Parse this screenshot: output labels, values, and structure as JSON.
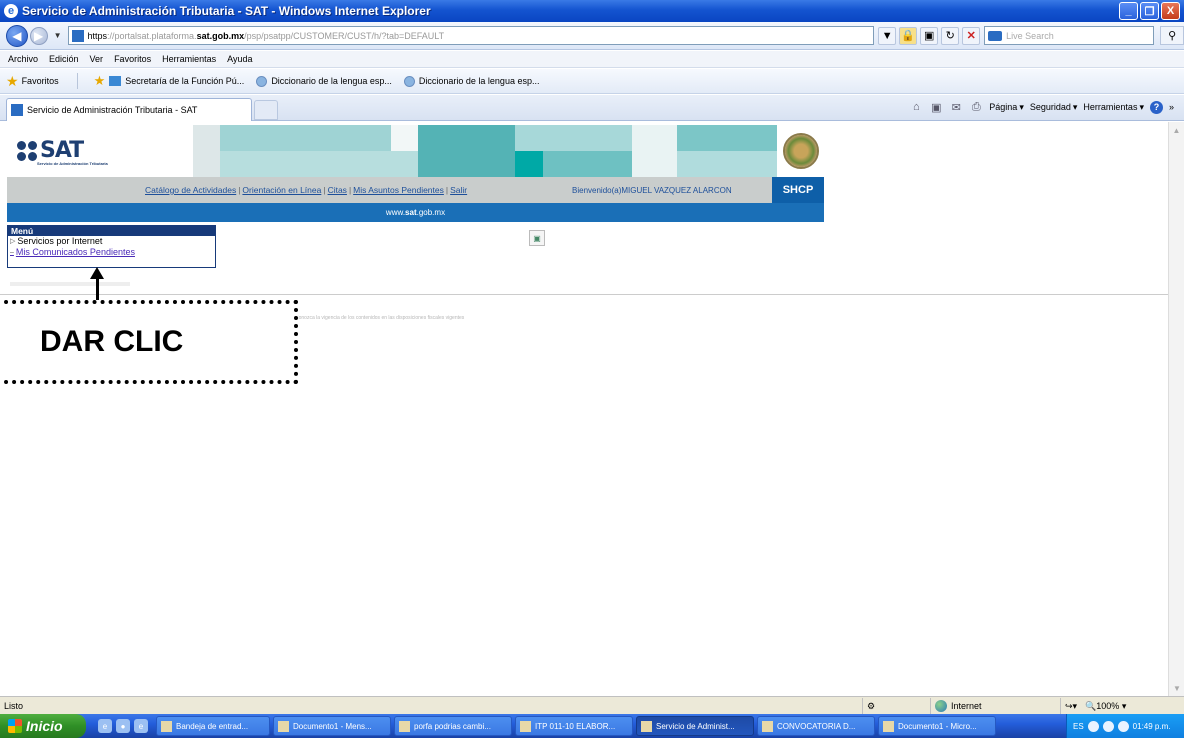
{
  "window": {
    "title": "Servicio de Administración Tributaria - SAT - Windows Internet Explorer",
    "controls": [
      "_",
      "❐",
      "X"
    ]
  },
  "address_bar": {
    "url_scheme": "https",
    "url_prefix": "://portalsat.plataforma.",
    "url_domain": "sat.gob.mx",
    "url_suffix": "/psp/psatpp/CUSTOMER/CUST/h/?tab=DEFAULT",
    "search_placeholder": "Live Search"
  },
  "menu": [
    "Archivo",
    "Edición",
    "Ver",
    "Favoritos",
    "Herramientas",
    "Ayuda"
  ],
  "favorites_bar": {
    "label": "Favoritos",
    "items": [
      "Secretaría de la Función Pú...",
      "Diccionario de la lengua esp...",
      "Diccionario de la lengua esp..."
    ]
  },
  "tab": {
    "label": "Servicio de Administración Tributaria - SAT"
  },
  "command_bar": {
    "page": "Página",
    "security": "Seguridad",
    "tools": "Herramientas"
  },
  "sat": {
    "logo": "SAT",
    "logo_sub": "Servicio de Administración Tributaria",
    "nav_links": [
      "Catálogo de Actividades",
      "Orientación en Línea",
      "Citas",
      "Mis Asuntos Pendientes",
      "Salir"
    ],
    "welcome": "Bienvenido(a)MIGUEL VAZQUEZ ALARCON",
    "shcp": "SHCP",
    "site_prefix": "www.",
    "site_bold": "sat",
    "site_suffix": ".gob.mx",
    "colors": {
      "navy": "#1e3f72",
      "blue_strip": "#1a6fb7",
      "shcp": "#0e5fa8",
      "teal": "#00a9a6"
    }
  },
  "menu_box": {
    "header": "Menú",
    "items": [
      "Servicios por Internet",
      "Mis Comunicados Pendientes"
    ]
  },
  "faded_text": "Conozca la vigencia de los contenidos en las disposiciones fiscales vigentes",
  "annotation": {
    "label": "DAR CLIC"
  },
  "status": {
    "text": "Listo",
    "zone": "Internet",
    "zoom": "100%"
  },
  "taskbar": {
    "start": "Inicio",
    "buttons": [
      "Bandeja de entrad...",
      "Documento1 - Mens...",
      "porfa podrias cambi...",
      "ITP 011-10 ELABOR...",
      "Servicio de Administ...",
      "CONVOCATORIA D...",
      "Documento1 - Micro..."
    ],
    "lang": "ES",
    "time": "01:49 p.m."
  }
}
